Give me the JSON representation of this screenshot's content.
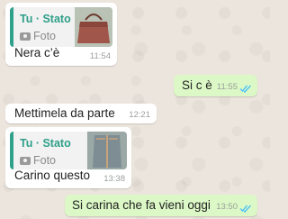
{
  "messages": [
    {
      "reply_author": "Tu · Stato",
      "reply_media": "Foto",
      "text": "Nera c’è",
      "time": "11:54"
    },
    {
      "text": "Si c è",
      "time": "11:55"
    },
    {
      "text": "Mettimela da parte",
      "time": "12:21"
    },
    {
      "reply_author": "Tu · Stato",
      "reply_media": "Foto",
      "text": "Carino questo",
      "time": "13:38"
    },
    {
      "text": "Si carina che fa vieni oggi",
      "time": "13:50"
    }
  ],
  "colors": {
    "accent": "#2fa089",
    "incoming": "#ffffff",
    "outgoing": "#dcf8c6",
    "read_ticks": "#4fc3f7"
  },
  "icons": {
    "media": "camera-icon",
    "status": "double-check-icon"
  }
}
